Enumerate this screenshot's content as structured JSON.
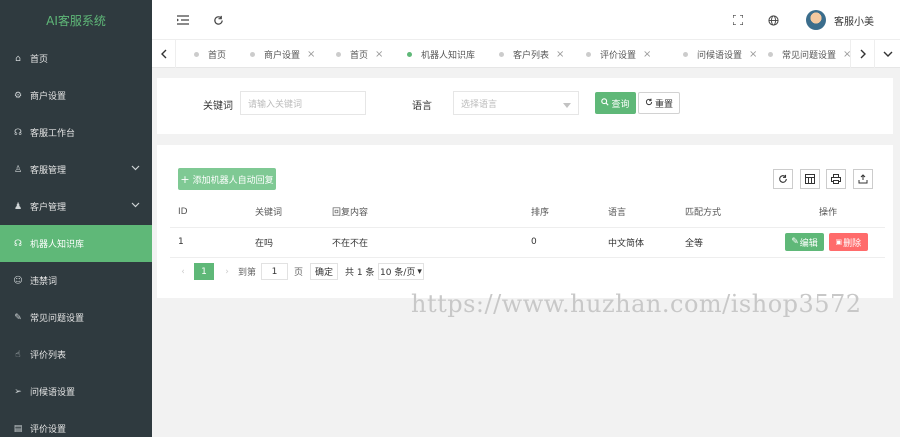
{
  "app": {
    "title": "AI客服系统"
  },
  "sidebar": {
    "items": [
      {
        "label": "首页",
        "icon": "home-icon"
      },
      {
        "label": "商户设置",
        "icon": "gear-icon"
      },
      {
        "label": "客服工作台",
        "icon": "headset-icon"
      },
      {
        "label": "客服管理",
        "icon": "user-icon",
        "expand": "chevron-down-icon"
      },
      {
        "label": "客户管理",
        "icon": "user-group-icon",
        "expand": "chevron-down-icon"
      },
      {
        "label": "机器人知识库",
        "icon": "robot-icon",
        "active": true
      },
      {
        "label": "违禁词",
        "icon": "ban-icon"
      },
      {
        "label": "常见问题设置",
        "icon": "question-icon"
      },
      {
        "label": "评价列表",
        "icon": "thumb-icon"
      },
      {
        "label": "问候语设置",
        "icon": "send-icon"
      },
      {
        "label": "评价设置",
        "icon": "form-icon"
      }
    ]
  },
  "header": {
    "username": "客服小美"
  },
  "tabs": [
    {
      "label": "首页",
      "closable": false
    },
    {
      "label": "商户设置",
      "closable": true
    },
    {
      "label": "首页",
      "closable": true
    },
    {
      "label": "机器人知识库",
      "closable": false,
      "active": true
    },
    {
      "label": "客户列表",
      "closable": true
    },
    {
      "label": "评价设置",
      "closable": true
    },
    {
      "label": "问候语设置",
      "closable": true
    },
    {
      "label": "常见问题设置",
      "closable": true
    }
  ],
  "search": {
    "keyword_label": "关键词",
    "keyword_placeholder": "请输入关键词",
    "language_label": "语言",
    "language_placeholder": "选择语言",
    "search_button": "查询",
    "reset_button": "重置"
  },
  "toolbar": {
    "add_button": "添加机器人自动回复"
  },
  "table": {
    "headers": [
      "ID",
      "关键词",
      "回复内容",
      "排序",
      "语言",
      "匹配方式",
      "操作"
    ],
    "rows": [
      {
        "id": "1",
        "keyword": "在吗",
        "reply": "不在不在",
        "sort": "0",
        "language": "中文简体",
        "match": "全等",
        "edit": "编辑",
        "delete": "删除"
      }
    ]
  },
  "pagination": {
    "current": "1",
    "goto_prefix": "到第",
    "goto_value": "1",
    "goto_suffix": "页",
    "confirm": "确定",
    "total": "共 1 条",
    "page_size": "10 条/页"
  },
  "watermark": "https://www.huzhan.com/ishop3572",
  "colors": {
    "accent": "#5fb878",
    "danger": "#ff5722",
    "sidebar": "#2f3a3f"
  }
}
